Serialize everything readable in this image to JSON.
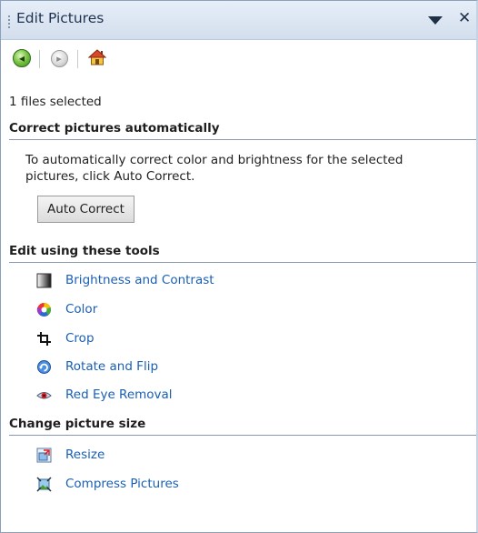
{
  "pane": {
    "title": "Edit Pictures",
    "close_glyph": "✕",
    "dropdown_icon": "triangle-down-icon"
  },
  "nav": {
    "back_icon": "back-arrow-icon",
    "forward_icon": "forward-arrow-icon",
    "home_icon": "home-icon"
  },
  "status": {
    "selection": "1 files selected"
  },
  "auto_section": {
    "heading": "Correct pictures automatically",
    "description": "To automatically correct color and brightness for the selected pictures, click Auto Correct.",
    "button_label": "Auto Correct"
  },
  "tools_section": {
    "heading": "Edit using these tools",
    "items": [
      {
        "label": "Brightness and Contrast",
        "icon": "brightness-contrast-icon"
      },
      {
        "label": "Color",
        "icon": "color-wheel-icon"
      },
      {
        "label": "Crop",
        "icon": "crop-icon"
      },
      {
        "label": "Rotate and Flip",
        "icon": "rotate-flip-icon"
      },
      {
        "label": "Red Eye Removal",
        "icon": "red-eye-icon"
      }
    ]
  },
  "size_section": {
    "heading": "Change picture size",
    "items": [
      {
        "label": "Resize",
        "icon": "resize-icon"
      },
      {
        "label": "Compress Pictures",
        "icon": "compress-pictures-icon"
      }
    ]
  },
  "colors": {
    "link": "#1a5fb4",
    "titlebar": "#dfe8f4",
    "section_rule": "#8a98ac"
  }
}
